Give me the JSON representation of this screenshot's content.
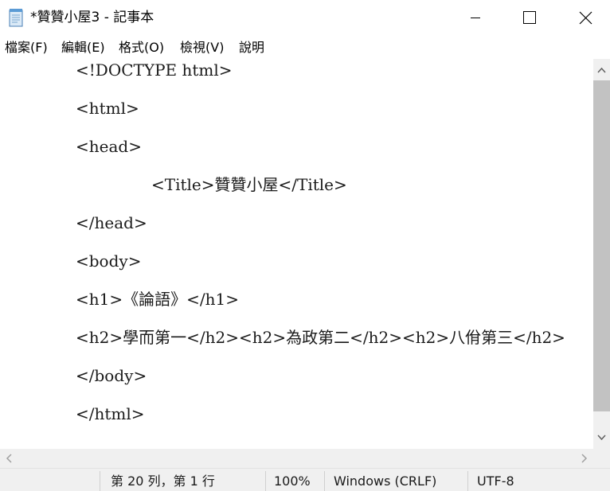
{
  "window": {
    "title": "*贊贊小屋3 - 記事本",
    "icon": "notepad-icon",
    "buttons": [
      "minimize-icon",
      "maximize-icon",
      "close-icon"
    ]
  },
  "menu": {
    "items": [
      {
        "label": "檔案(F)"
      },
      {
        "label": "編輯(E)"
      },
      {
        "label": "格式(O)"
      },
      {
        "label": "檢視(V)"
      },
      {
        "label": "說明"
      }
    ]
  },
  "editor": {
    "lines": [
      "<!DOCTYPE html>",
      "<html>",
      "<head>",
      "<Title>贊贊小屋</Title>",
      "</head>",
      "<body>",
      "<h1>《論語》</h1>",
      "<h2>學而第一</h2><h2>為政第二</h2><h2>八佾第三</h2>",
      "</body>",
      "</html>"
    ]
  },
  "status": {
    "position": "第 20 列，第 1 行",
    "zoom": "100%",
    "line_ending": "Windows (CRLF)",
    "encoding": "UTF-8"
  },
  "colors": {
    "scrollbar_track": "#f0f0f0",
    "scrollbar_thumb": "#c2c2c2",
    "statusbar": "#f0f0f0"
  }
}
